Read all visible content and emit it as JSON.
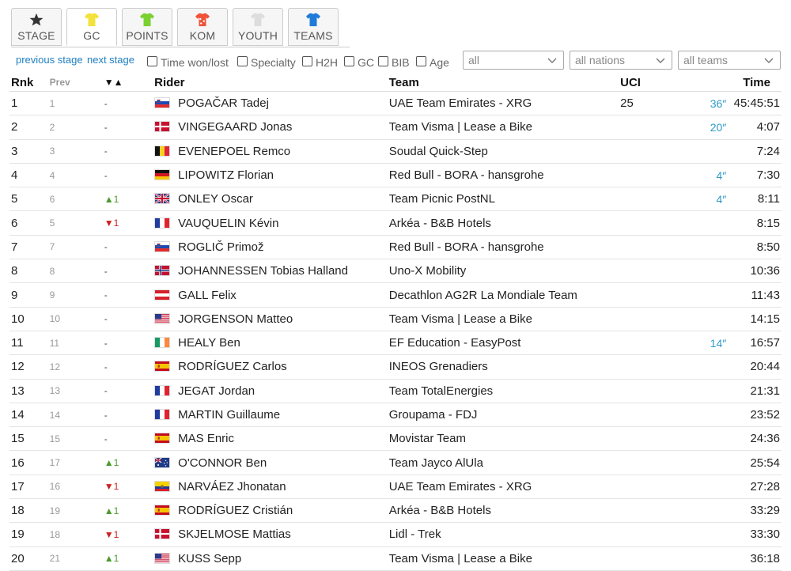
{
  "tabs": [
    {
      "label": "STAGE",
      "icon": "star-icon",
      "color": "#333333",
      "active": false
    },
    {
      "label": "GC",
      "icon": "jersey-yellow-icon",
      "color": "#f2e23a",
      "active": true
    },
    {
      "label": "POINTS",
      "icon": "jersey-green-icon",
      "color": "#7bd12f",
      "active": false
    },
    {
      "label": "KOM",
      "icon": "jersey-polka-icon",
      "color": "#f0533a",
      "active": false
    },
    {
      "label": "YOUTH",
      "icon": "jersey-white-icon",
      "color": "#dddddd",
      "active": false
    },
    {
      "label": "TEAMS",
      "icon": "jersey-blue-icon",
      "color": "#1f7bd8",
      "active": false
    }
  ],
  "filters": {
    "previous_stage": "previous stage",
    "next_stage": "next stage",
    "checkboxes": [
      "Time won/lost",
      "Specialty",
      "H2H",
      "GC",
      "BIB",
      "Age"
    ],
    "select_all": "all",
    "select_nations": "all nations",
    "select_teams": "all teams"
  },
  "headers": {
    "rnk": "Rnk",
    "prev": "Prev",
    "change": "▼▲",
    "rider": "Rider",
    "team": "Team",
    "uci": "UCI",
    "time": "Time"
  },
  "colors": {
    "link": "#1e7fc1",
    "bonus": "#2f9ac8",
    "up": "#4a9a2c",
    "down": "#cc2222"
  },
  "rows": [
    {
      "rnk": "1",
      "prev": "1",
      "change": "-",
      "dir": "same",
      "flag": "si",
      "rider": "POGAČAR Tadej",
      "team": "UAE Team Emirates - XRG",
      "uci": "25",
      "bonus": "36″",
      "time": "45:45:51"
    },
    {
      "rnk": "2",
      "prev": "2",
      "change": "-",
      "dir": "same",
      "flag": "dk",
      "rider": "VINGEGAARD Jonas",
      "team": "Team Visma | Lease a Bike",
      "uci": "",
      "bonus": "20″",
      "time": "4:07"
    },
    {
      "rnk": "3",
      "prev": "3",
      "change": "-",
      "dir": "same",
      "flag": "be",
      "rider": "EVENEPOEL Remco",
      "team": "Soudal Quick-Step",
      "uci": "",
      "bonus": "",
      "time": "7:24"
    },
    {
      "rnk": "4",
      "prev": "4",
      "change": "-",
      "dir": "same",
      "flag": "de",
      "rider": "LIPOWITZ Florian",
      "team": "Red Bull - BORA - hansgrohe",
      "uci": "",
      "bonus": "4″",
      "time": "7:30"
    },
    {
      "rnk": "5",
      "prev": "6",
      "change": "▲1",
      "dir": "up",
      "flag": "gb",
      "rider": "ONLEY Oscar",
      "team": "Team Picnic PostNL",
      "uci": "",
      "bonus": "4″",
      "time": "8:11"
    },
    {
      "rnk": "6",
      "prev": "5",
      "change": "▼1",
      "dir": "down",
      "flag": "fr",
      "rider": "VAUQUELIN Kévin",
      "team": "Arkéa - B&B Hotels",
      "uci": "",
      "bonus": "",
      "time": "8:15"
    },
    {
      "rnk": "7",
      "prev": "7",
      "change": "-",
      "dir": "same",
      "flag": "si",
      "rider": "ROGLIČ Primož",
      "team": "Red Bull - BORA - hansgrohe",
      "uci": "",
      "bonus": "",
      "time": "8:50"
    },
    {
      "rnk": "8",
      "prev": "8",
      "change": "-",
      "dir": "same",
      "flag": "no",
      "rider": "JOHANNESSEN Tobias Halland",
      "team": "Uno-X Mobility",
      "uci": "",
      "bonus": "",
      "time": "10:36"
    },
    {
      "rnk": "9",
      "prev": "9",
      "change": "-",
      "dir": "same",
      "flag": "at",
      "rider": "GALL Felix",
      "team": "Decathlon AG2R La Mondiale Team",
      "uci": "",
      "bonus": "",
      "time": "11:43"
    },
    {
      "rnk": "10",
      "prev": "10",
      "change": "-",
      "dir": "same",
      "flag": "us",
      "rider": "JORGENSON Matteo",
      "team": "Team Visma | Lease a Bike",
      "uci": "",
      "bonus": "",
      "time": "14:15"
    },
    {
      "rnk": "11",
      "prev": "11",
      "change": "-",
      "dir": "same",
      "flag": "ie",
      "rider": "HEALY Ben",
      "team": "EF Education - EasyPost",
      "uci": "",
      "bonus": "14″",
      "time": "16:57"
    },
    {
      "rnk": "12",
      "prev": "12",
      "change": "-",
      "dir": "same",
      "flag": "es",
      "rider": "RODRÍGUEZ Carlos",
      "team": "INEOS Grenadiers",
      "uci": "",
      "bonus": "",
      "time": "20:44"
    },
    {
      "rnk": "13",
      "prev": "13",
      "change": "-",
      "dir": "same",
      "flag": "fr",
      "rider": "JEGAT Jordan",
      "team": "Team TotalEnergies",
      "uci": "",
      "bonus": "",
      "time": "21:31"
    },
    {
      "rnk": "14",
      "prev": "14",
      "change": "-",
      "dir": "same",
      "flag": "fr",
      "rider": "MARTIN Guillaume",
      "team": "Groupama - FDJ",
      "uci": "",
      "bonus": "",
      "time": "23:52"
    },
    {
      "rnk": "15",
      "prev": "15",
      "change": "-",
      "dir": "same",
      "flag": "es",
      "rider": "MAS Enric",
      "team": "Movistar Team",
      "uci": "",
      "bonus": "",
      "time": "24:36"
    },
    {
      "rnk": "16",
      "prev": "17",
      "change": "▲1",
      "dir": "up",
      "flag": "au",
      "rider": "O'CONNOR Ben",
      "team": "Team Jayco AlUla",
      "uci": "",
      "bonus": "",
      "time": "25:54"
    },
    {
      "rnk": "17",
      "prev": "16",
      "change": "▼1",
      "dir": "down",
      "flag": "ec",
      "rider": "NARVÁEZ Jhonatan",
      "team": "UAE Team Emirates - XRG",
      "uci": "",
      "bonus": "",
      "time": "27:28"
    },
    {
      "rnk": "18",
      "prev": "19",
      "change": "▲1",
      "dir": "up",
      "flag": "es",
      "rider": "RODRÍGUEZ Cristián",
      "team": "Arkéa - B&B Hotels",
      "uci": "",
      "bonus": "",
      "time": "33:29"
    },
    {
      "rnk": "19",
      "prev": "18",
      "change": "▼1",
      "dir": "down",
      "flag": "dk",
      "rider": "SKJELMOSE Mattias",
      "team": "Lidl - Trek",
      "uci": "",
      "bonus": "",
      "time": "33:30"
    },
    {
      "rnk": "20",
      "prev": "21",
      "change": "▲1",
      "dir": "up",
      "flag": "us",
      "rider": "KUSS Sepp",
      "team": "Team Visma | Lease a Bike",
      "uci": "",
      "bonus": "",
      "time": "36:18"
    }
  ]
}
